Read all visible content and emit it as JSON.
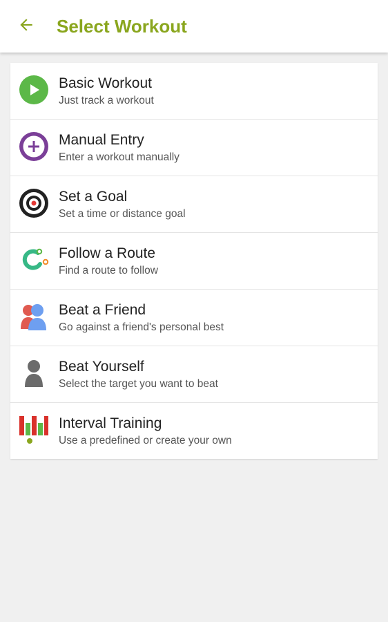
{
  "header": {
    "title": "Select Workout",
    "back_icon": "arrow-left-icon"
  },
  "colors": {
    "accent": "#8aa61e",
    "background": "#f0f0f0",
    "card": "#ffffff"
  },
  "items": [
    {
      "title": "Basic Workout",
      "subtitle": "Just track a workout",
      "icon": "play-icon"
    },
    {
      "title": "Manual Entry",
      "subtitle": "Enter a workout manually",
      "icon": "plus-circle-icon"
    },
    {
      "title": "Set a Goal",
      "subtitle": "Set a time or distance goal",
      "icon": "target-icon"
    },
    {
      "title": "Follow a Route",
      "subtitle": "Find a route to follow",
      "icon": "route-icon"
    },
    {
      "title": "Beat a Friend",
      "subtitle": "Go against a friend's personal best",
      "icon": "friends-icon"
    },
    {
      "title": "Beat Yourself",
      "subtitle": "Select the target you want to beat",
      "icon": "person-icon"
    },
    {
      "title": "Interval Training",
      "subtitle": "Use a predefined or create your own",
      "icon": "interval-bars-icon"
    }
  ]
}
